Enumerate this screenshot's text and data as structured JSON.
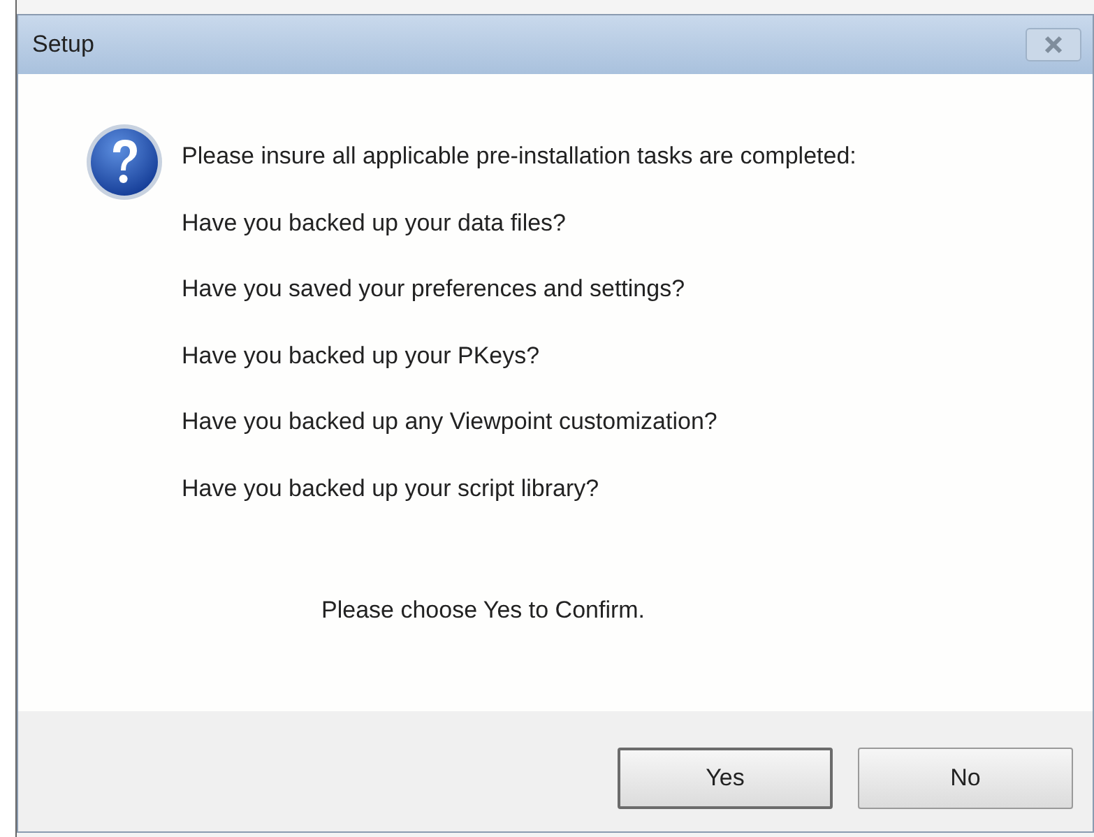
{
  "window": {
    "title": "Setup"
  },
  "message": {
    "intro": "Please insure all applicable pre-installation tasks are completed:",
    "questions": [
      "Have you backed up your data files?",
      "Have you saved your preferences and settings?",
      "Have you backed up your PKeys?",
      "Have you backed up any Viewpoint customization?",
      "Have you backed up your script library?"
    ],
    "prompt": "Please choose Yes to Confirm."
  },
  "buttons": [
    {
      "label": "Yes",
      "default": true
    },
    {
      "label": "No",
      "default": false
    }
  ]
}
